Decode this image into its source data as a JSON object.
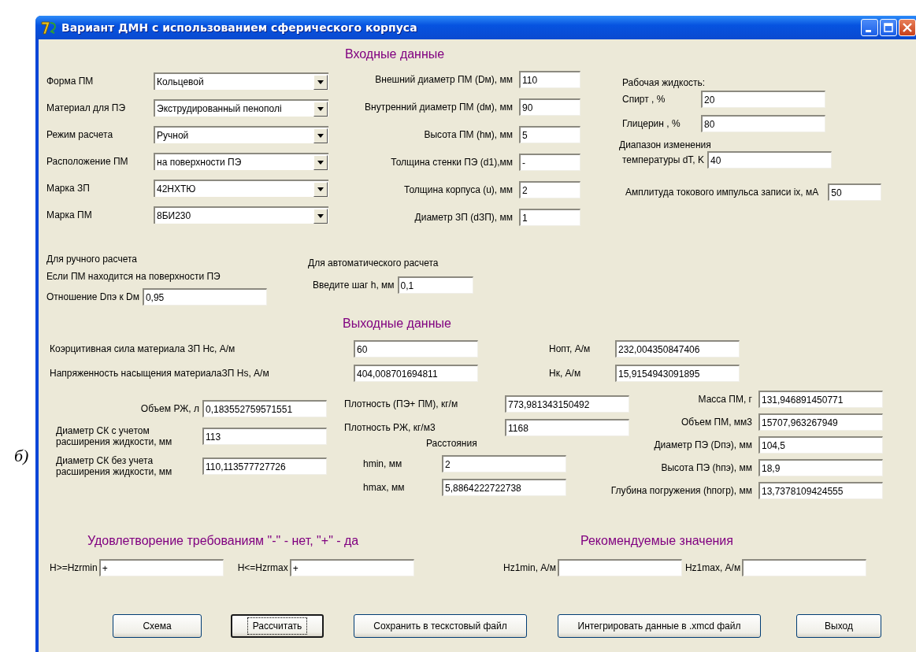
{
  "caption": "б)",
  "window": {
    "title": "Вариант ДМН с использованием сферического корпуса"
  },
  "input": {
    "heading": "Входные данные",
    "combos": [
      {
        "label": "Форма ПМ",
        "value": "Кольцевой"
      },
      {
        "label": "Материал для ПЭ",
        "value": "Экструдированный пенополі"
      },
      {
        "label": "Режим расчета",
        "value": "Ручной"
      },
      {
        "label": "Расположение ПМ",
        "value": "на поверхности ПЭ"
      },
      {
        "label": "Марка ЗП",
        "value": "42НХТЮ"
      },
      {
        "label": "Марка ПМ",
        "value": "8БИ230"
      }
    ],
    "fields": [
      {
        "label": "Внешний диаметр ПМ (Dм), мм",
        "value": "110"
      },
      {
        "label": "Внутренний диаметр ПМ (dм), мм",
        "value": "90"
      },
      {
        "label": "Высота ПМ (hм), мм",
        "value": "5"
      },
      {
        "label": "Толщина стенки ПЭ (d1),мм",
        "value": "-"
      },
      {
        "label": "Толщина корпуса (u), мм",
        "value": "2"
      },
      {
        "label": "Диаметр ЗП (dЗП), мм",
        "value": "1"
      }
    ],
    "fluid": {
      "heading": "Рабочая жидкость:",
      "fields": [
        {
          "label": "Спирт , %",
          "value": "20"
        },
        {
          "label": "Глицерин , %",
          "value": "80"
        }
      ]
    },
    "temperature": {
      "lines": [
        "Диапазон изменения",
        "температуры dT, K"
      ],
      "value": "40"
    },
    "amplitude": {
      "label": "Амплитуда токового импульса записи ix, мА",
      "value": "50"
    },
    "manual": {
      "heading": "Для ручного расчета",
      "note": "Если ПМ находится на поверхности ПЭ",
      "label": "Отношение Dпэ к Dм",
      "value": "0,95"
    },
    "auto": {
      "heading": "Для автоматического расчета",
      "label": "Введите шаг h, мм",
      "value": "0,1"
    }
  },
  "output": {
    "heading": "Выходные данные",
    "rows": [
      {
        "label": "Коэрцитивная сила материала ЗП Hc, А/м",
        "value": "60",
        "label2": "Hопт, А/м",
        "value2": "232,004350847406"
      },
      {
        "label": "Напряженность насыщения материалаЗП Hs, А/м",
        "value": "404,008701694811",
        "label2": "Hк, А/м",
        "value2": "15,9154943091895"
      }
    ],
    "left": [
      {
        "lines": [
          "Объем РЖ, л"
        ],
        "value": "0,183552759571551"
      },
      {
        "lines": [
          "Диаметр СК с учетом",
          "расширения жидкости, мм"
        ],
        "value": "113"
      },
      {
        "lines": [
          "Диаметр СК без учета",
          "расширения жидкости, мм"
        ],
        "value": "110,113577727726"
      }
    ],
    "middle": [
      {
        "label": "Плотность (ПЭ+ ПМ), кг/м",
        "value": "773,981343150492"
      },
      {
        "label": "Плотность РЖ, кг/м3",
        "value": "1168"
      }
    ],
    "distances": {
      "heading": "Расстояния",
      "fields": [
        {
          "label": "hmin, мм",
          "value": "2"
        },
        {
          "label": "hmax, мм",
          "value": "5,8864222722738"
        }
      ]
    },
    "right": [
      {
        "label": "Масса ПМ, г",
        "value": "131,946891450771"
      },
      {
        "label": "Объем ПМ, мм3",
        "value": "15707,963267949"
      },
      {
        "label": "Диаметр ПЭ (Dпэ), мм",
        "value": "104,5"
      },
      {
        "label": "Высота ПЭ (hпэ), мм",
        "value": "18,9"
      },
      {
        "label": "Глубина погружения (hпогр), мм",
        "value": "13,7378109424555"
      }
    ]
  },
  "requirements": {
    "heading": "Удовлетворение требованиям \"-\" - нет, \"+\" - да",
    "fields": [
      {
        "label": "H>=Hzrmin",
        "value": "+"
      },
      {
        "label": "H<=Hzrmax",
        "value": "+"
      }
    ]
  },
  "recommended": {
    "heading": "Рекомендуемые значения",
    "fields": [
      {
        "label": "Hz1min, А/м"
      },
      {
        "label": "Hz1max, А/м"
      }
    ]
  },
  "buttons": [
    {
      "label": "Схема",
      "focused": false
    },
    {
      "label": "Рассчитать",
      "focused": true
    },
    {
      "label": "Сохранить в тескстовый файл",
      "focused": false
    },
    {
      "label": "Интегрировать данные в .xmcd файл",
      "focused": false
    },
    {
      "label": "Выход",
      "focused": false
    }
  ]
}
